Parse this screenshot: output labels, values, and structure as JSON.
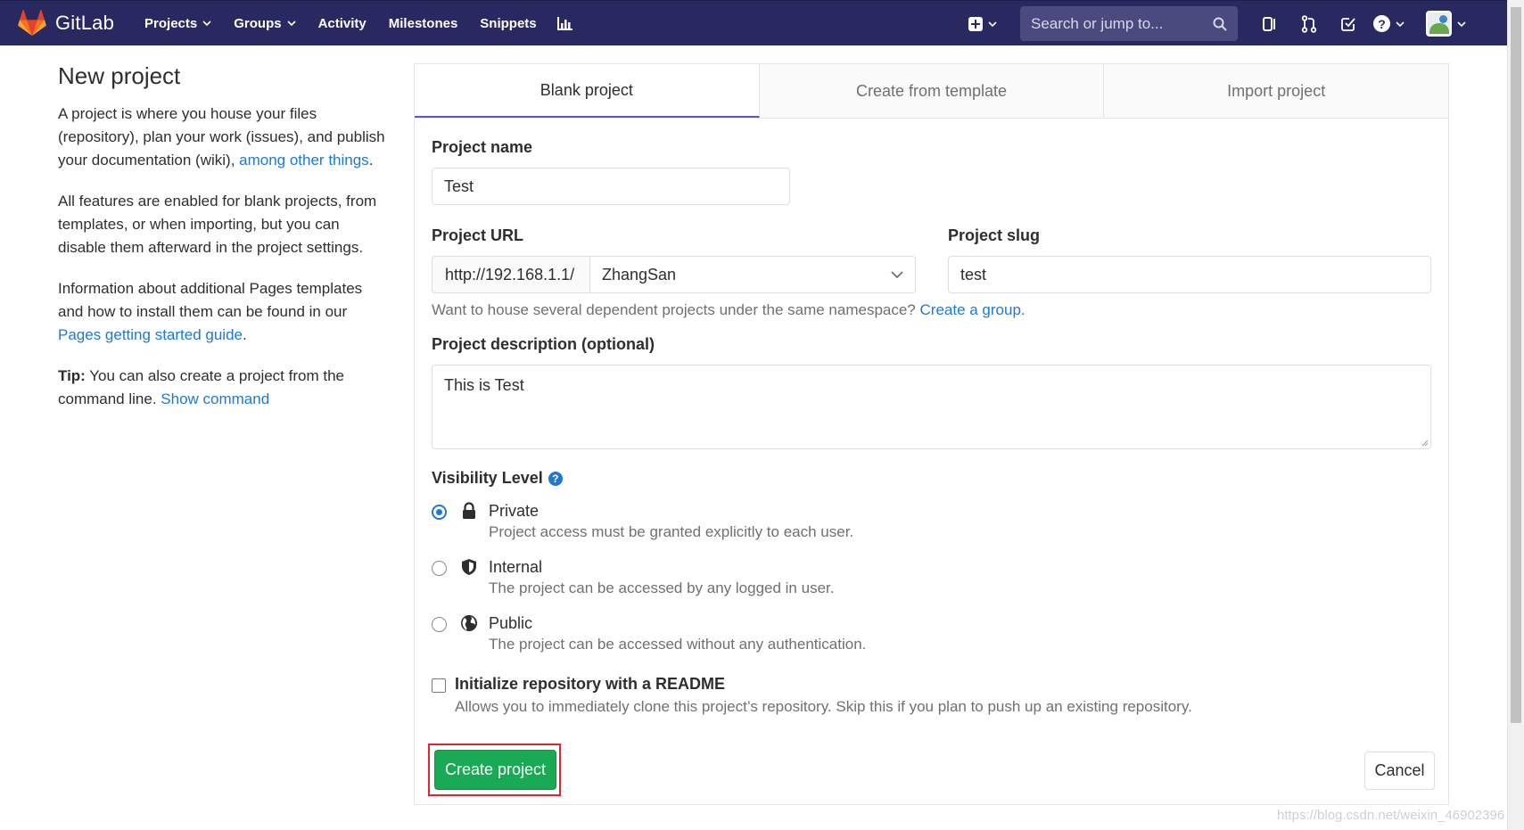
{
  "navbar": {
    "brand": "GitLab",
    "links": [
      "Projects",
      "Groups",
      "Activity",
      "Milestones",
      "Snippets"
    ],
    "search_placeholder": "Search or jump to...",
    "icons": [
      "gitlab-logo-icon",
      "chart-icon",
      "plus-icon",
      "search-icon",
      "sidebar-toggle-icon",
      "merge-request-icon",
      "todo-icon",
      "help-icon",
      "avatar"
    ],
    "brand_color": "#292961"
  },
  "intro": {
    "title": "New project",
    "p1_text": "A project is where you house your files (repository), plan your work (issues), and publish your documentation (wiki), ",
    "p1_link": "among other things",
    "p1_end": ".",
    "p2": "All features are enabled for blank projects, from templates, or when importing, but you can disable them afterward in the project settings.",
    "p3_text": "Information about additional Pages templates and how to install them can be found in our ",
    "p3_link": "Pages getting started guide",
    "p3_end": ".",
    "tip_label": "Tip:",
    "tip_text": " You can also create a project from the command line. ",
    "tip_link": "Show command"
  },
  "tabs": [
    "Blank project",
    "Create from template",
    "Import project"
  ],
  "form": {
    "project_name_label": "Project name",
    "project_name_value": "Test",
    "project_url_label": "Project URL",
    "url_prefix": "http://192.168.1.1/",
    "namespace": "ZhangSan",
    "project_slug_label": "Project slug",
    "project_slug_value": "test",
    "namespace_hint": "Want to house several dependent projects under the same namespace? ",
    "namespace_hint_link": "Create a group.",
    "description_label": "Project description (optional)",
    "description_value": "This is Test",
    "visibility_label": "Visibility Level",
    "visibility": [
      {
        "title": "Private",
        "desc": "Project access must be granted explicitly to each user.",
        "icon": "lock-icon",
        "checked": true
      },
      {
        "title": "Internal",
        "desc": "The project can be accessed by any logged in user.",
        "icon": "shield-icon",
        "checked": false
      },
      {
        "title": "Public",
        "desc": "The project can be accessed without any authentication.",
        "icon": "globe-icon",
        "checked": false
      }
    ],
    "readme_label": "Initialize repository with a README",
    "readme_desc": "Allows you to immediately clone this project’s repository. Skip this if you plan to push up an existing repository.",
    "create_button": "Create project",
    "cancel_button": "Cancel",
    "create_color": "#1aaa55",
    "highlight_color": "#e0262f"
  },
  "watermark": "https://blog.csdn.net/weixin_46902396"
}
